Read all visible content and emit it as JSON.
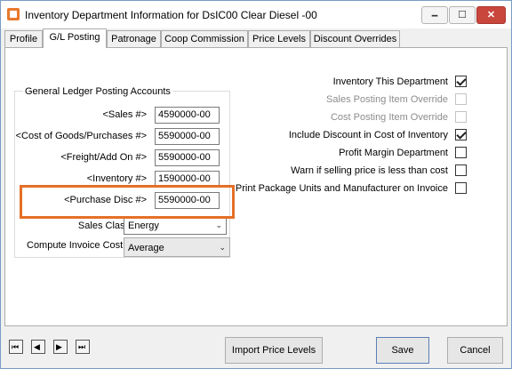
{
  "window": {
    "title": "Inventory Department Information for DsIC00  Clear Diesel -00",
    "min_glyph": "🗕",
    "max_glyph": "☐",
    "close_glyph": "✕",
    "icon": "app-icon"
  },
  "tabs": [
    {
      "label": "Profile"
    },
    {
      "label": "G/L Posting"
    },
    {
      "label": "Patronage"
    },
    {
      "label": "Coop Commission"
    },
    {
      "label": "Price Levels"
    },
    {
      "label": "Discount Overrides"
    }
  ],
  "gl_group": {
    "title": "General Ledger Posting Accounts",
    "fields": [
      {
        "label": "<Sales #>",
        "value": "4590000-00"
      },
      {
        "label": "<Cost of Goods/Purchases #>",
        "value": "5590000-00"
      },
      {
        "label": "<Freight/Add On #>",
        "value": "5590000-00"
      },
      {
        "label": "<Inventory #>",
        "value": "1590000-00"
      },
      {
        "label": "<Purchase Disc #>",
        "value": "5590000-00"
      }
    ]
  },
  "sales_class": {
    "label": "Sales Class",
    "value": "Energy"
  },
  "compute_cost": {
    "label": "Compute Invoice Cost",
    "value": "Average"
  },
  "options": [
    {
      "label": "Inventory This Department",
      "checked": true,
      "enabled": true
    },
    {
      "label": "Sales Posting Item Override",
      "checked": false,
      "enabled": false
    },
    {
      "label": "Cost Posting Item Override",
      "checked": false,
      "enabled": false
    },
    {
      "label": "Include Discount in Cost of Inventory",
      "checked": true,
      "enabled": true
    },
    {
      "label": "Profit Margin Department",
      "checked": false,
      "enabled": true
    },
    {
      "label": "Warn if selling price is less than cost",
      "checked": false,
      "enabled": true
    },
    {
      "label": "Print Package Units and Manufacturer on Invoice",
      "checked": false,
      "enabled": true
    }
  ],
  "nav": {
    "first": "⏮",
    "prev": "◀",
    "next": "▶",
    "last": "⏭"
  },
  "buttons": {
    "import_price_levels": "Import Price Levels",
    "save": "Save",
    "cancel": "Cancel"
  },
  "colors": {
    "highlight": "#e56f27",
    "close_button": "#c9463d"
  }
}
